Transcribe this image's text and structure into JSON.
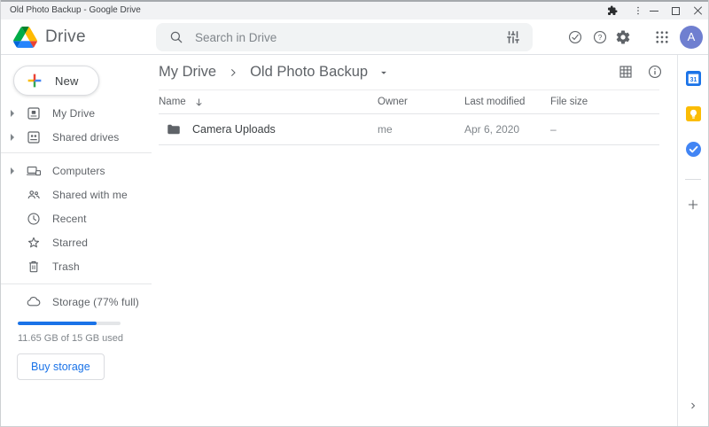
{
  "window": {
    "title": "Old Photo Backup - Google Drive"
  },
  "header": {
    "app_name": "Drive",
    "search": {
      "placeholder": "Search in Drive"
    },
    "avatar_letter": "A"
  },
  "sidebar": {
    "new_button_label": "New",
    "items": [
      {
        "label": "My Drive",
        "expandable": true
      },
      {
        "label": "Shared drives",
        "expandable": true
      },
      {
        "label": "Computers",
        "expandable": true
      },
      {
        "label": "Shared with me",
        "expandable": false
      },
      {
        "label": "Recent",
        "expandable": false
      },
      {
        "label": "Starred",
        "expandable": false
      },
      {
        "label": "Trash",
        "expandable": false
      }
    ],
    "storage": {
      "label": "Storage (77% full)",
      "percent_full": 77,
      "usage_text": "11.65 GB of 15 GB used",
      "buy_button_label": "Buy storage"
    }
  },
  "main": {
    "breadcrumb": {
      "root": "My Drive",
      "current": "Old Photo Backup"
    },
    "table": {
      "columns": {
        "name": "Name",
        "owner": "Owner",
        "last_modified": "Last modified",
        "file_size": "File size"
      },
      "rows": [
        {
          "name": "Camera Uploads",
          "type": "folder",
          "owner": "me",
          "last_modified": "Apr 6, 2020",
          "file_size": "–"
        }
      ]
    }
  },
  "side_panel": {
    "icons": [
      "calendar",
      "keep",
      "tasks",
      "add"
    ]
  },
  "colors": {
    "accent_blue": "#1a73e8",
    "icon_gray": "#5f6368",
    "avatar_bg": "#6f7fd0",
    "keep_yellow": "#fbbc04",
    "tasks_blue": "#4285f4",
    "folder_gray": "#5f6368",
    "progress_fill": "#1a73e8",
    "search_bg": "#f1f3f4"
  }
}
